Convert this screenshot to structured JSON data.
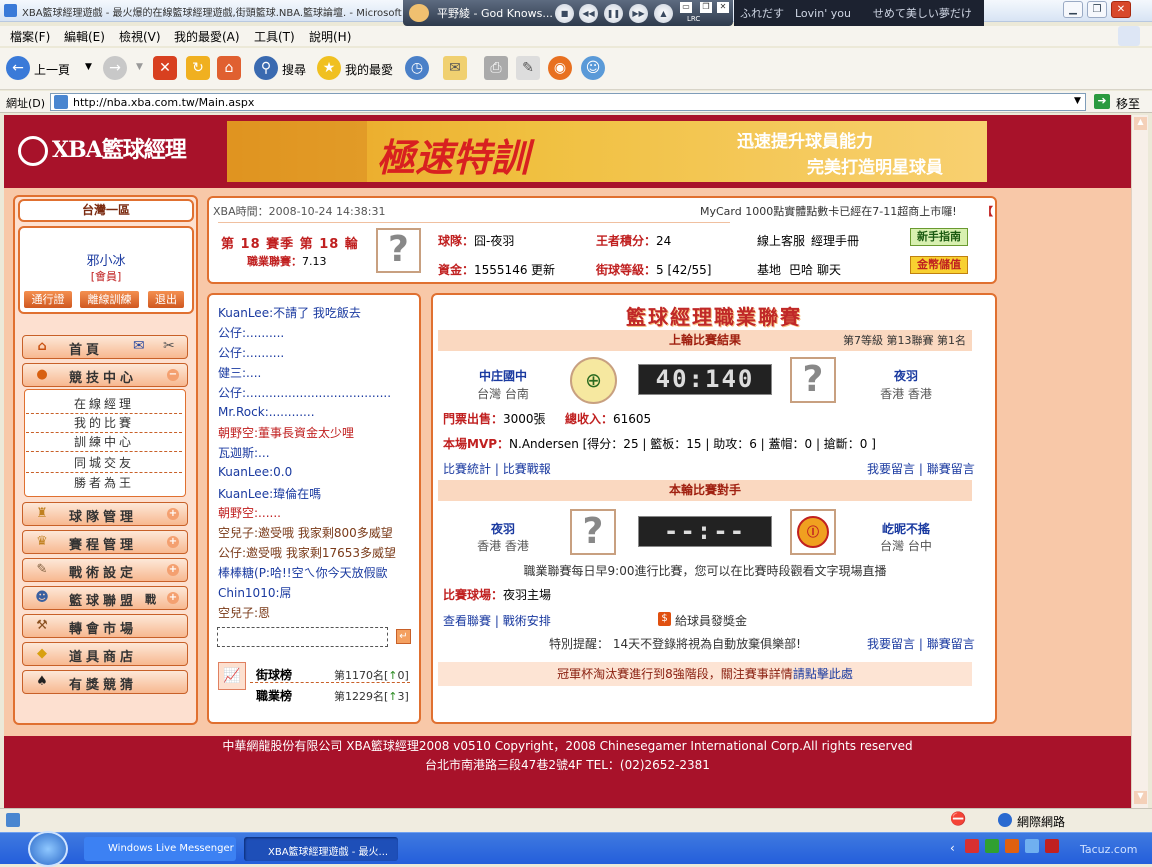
{
  "window": {
    "title": "XBA籃球經理遊戲 - 最火爆的在線籃球經理遊戲,街頭籃球.NBA.籃球論壇. - Microsoft I"
  },
  "media_player": {
    "song": "平野綾 - God Knows...",
    "lyric": "ふれだす　Lovin' you　　せめて美しい夢だけ",
    "lrc": "LRC"
  },
  "menu": {
    "items": [
      "檔案(F)",
      "編輯(E)",
      "檢視(V)",
      "我的最愛(A)",
      "工具(T)",
      "說明(H)"
    ]
  },
  "toolbar": {
    "back": "上一頁",
    "search": "搜尋",
    "favorites": "我的最愛"
  },
  "address": {
    "label": "網址(D)",
    "url": "http://nba.xba.com.tw/Main.aspx",
    "go": "移至"
  },
  "site": {
    "logo": "XBA籃球經理",
    "banner": {
      "title": "極速特訓",
      "line1": "迅速提升球員能力",
      "line2": "完美打造明星球員"
    }
  },
  "sidebar": {
    "server": "台灣一區",
    "user": "邪小冰",
    "role": "[會員]",
    "buttons": [
      "通行證",
      "離線訓練",
      "退出"
    ],
    "nav": [
      {
        "label": "首頁",
        "icon": "home-icon"
      },
      {
        "label": "競技中心",
        "icon": "basketball-icon"
      },
      {
        "label": "球隊管理",
        "icon": "team-icon"
      },
      {
        "label": "賽程管理",
        "icon": "trophy-icon"
      },
      {
        "label": "戰術設定",
        "icon": "tactics-icon"
      },
      {
        "label": "籃球聯盟",
        "icon": "league-icon",
        "suffix": "戰"
      },
      {
        "label": "轉會市場",
        "icon": "gavel-icon"
      },
      {
        "label": "道具商店",
        "icon": "gold-icon"
      },
      {
        "label": "有獎競猜",
        "icon": "spade-icon"
      }
    ],
    "sub": [
      "在線經理",
      "我的比賽",
      "訓練中心",
      "同城交友",
      "勝者為王"
    ]
  },
  "info": {
    "time_label": "XBA時間：",
    "time": "2008-10-24 14:38:31",
    "marquee": "MyCard 1000點實體點數卡已經在7-11超商上市囉!",
    "season": "第 18 賽季  第 18 輪",
    "league_label": "職業聯賽：",
    "league_value": "7.13",
    "team_label": "球隊：",
    "team": "囧-夜羽",
    "king_label": "王者積分：",
    "king": "24",
    "service": "線上客服",
    "manual": "經理手冊",
    "newbie": "新手指南",
    "money_label": "資金：",
    "money": "1555146",
    "update": "更新",
    "level_label": "街球等級：",
    "level": "5 [42/55]",
    "base": "基地",
    "bar": "巴哈",
    "chat": "聊天",
    "deposit": "金幣儲值"
  },
  "chat": {
    "lines": [
      {
        "name": "KuanLee",
        "text": ":不請了 我吃飯去",
        "c": "blue"
      },
      {
        "name": "公仔",
        "text": ":..........",
        "c": "blue"
      },
      {
        "name": "公仔",
        "text": ":..........",
        "c": "blue"
      },
      {
        "name": "健三",
        "text": ":....",
        "c": "blue"
      },
      {
        "name": "公仔",
        "text": ":......................................",
        "c": "blue"
      },
      {
        "name": "Mr.Rock",
        "text": ":............",
        "c": "blue"
      },
      {
        "name": "朝野空",
        "text": ":董事長資金太少哩",
        "c": "red"
      },
      {
        "name": "瓦迦斯",
        "text": ":...",
        "c": "blue"
      },
      {
        "name": "KuanLee",
        "text": ":0.0",
        "c": "blue"
      },
      {
        "name": "KuanLee",
        "text": ":瑋倫在嗎",
        "c": "blue"
      },
      {
        "name": "朝野空",
        "text": ":......",
        "c": "red"
      },
      {
        "name": "空兒子",
        "text": ":邀受哦  我家剩800多威望",
        "c": "brown"
      },
      {
        "name": "公仔",
        "text": ":邀受哦  我家剩17653多威望",
        "c": "brown"
      },
      {
        "name": "棒棒糖",
        "text": "(P:哈!!空ㄟ你今天放假歐",
        "c": "blue"
      },
      {
        "name": "Chin1010",
        "text": ":屌",
        "c": "blue"
      },
      {
        "name": "空兒子",
        "text": ":恩",
        "c": "brown"
      }
    ],
    "rank1_label": "街球榜",
    "rank1": "第1170名[",
    "rank1_up": "0",
    "rank2_label": "職業榜",
    "rank2": "第1229名[",
    "rank2_up": "3",
    "rank_close": "]"
  },
  "main": {
    "title": "籃球經理職業聯賽",
    "last_title": "上輪比賽結果",
    "last_meta": "第7等級  第13聯賽  第1名",
    "home_team": "中庄國中",
    "home_loc": "台灣  台南",
    "score": "40:140",
    "away_team": "夜羽",
    "away_loc": "香港  香港",
    "ticket_label": "門票出售：",
    "ticket": "3000張",
    "income_label": "總收入：",
    "income": "61605",
    "mvp_label": "本場MVP：",
    "mvp": "N.Andersen  [得分：25 | 籃板：15 | 助攻：6 | 蓋帽：0 | 搶斷：0 ]",
    "stats": "比賽統計",
    "report": "比賽戰報",
    "msg1": "我要留言",
    "msg2": "聯賽留言",
    "sep": "|",
    "next_title": "本輪比賽對手",
    "next_home": "夜羽",
    "next_home_loc": "香港  香港",
    "next_score": "--:--",
    "next_away": "屹昵不搖",
    "next_away_loc": "台灣  台中",
    "notice": "職業聯賽每日早9:00進行比賽，您可以在比賽時段觀看文字現場直播",
    "venue_label": "比賽球場：",
    "venue": "夜羽主場",
    "view_league": "查看聯賽",
    "tactics": "戰術安排",
    "bonus": "給球員發獎金",
    "warn": "特別提醒：  14天不登錄將視為自動放棄俱樂部!",
    "cup": "冠軍杯淘汰賽進行到8強階段，關注賽事詳情",
    "cup_link": "請點擊此處"
  },
  "footer": {
    "line1": "中華網龍股份有限公司  XBA籃球經理2008 v0510    Copyright，2008 Chinesegamer International Corp.All rights reserved",
    "line2": "台北市南港路三段47巷2號4F TEL：(02)2652-2381"
  },
  "status": {
    "zone": "網際網路"
  },
  "taskbar": {
    "t1": "Windows Live Messenger",
    "t2": "XBA籃球經理遊戲 - 最火...",
    "watermark": "Tacuz.com"
  }
}
